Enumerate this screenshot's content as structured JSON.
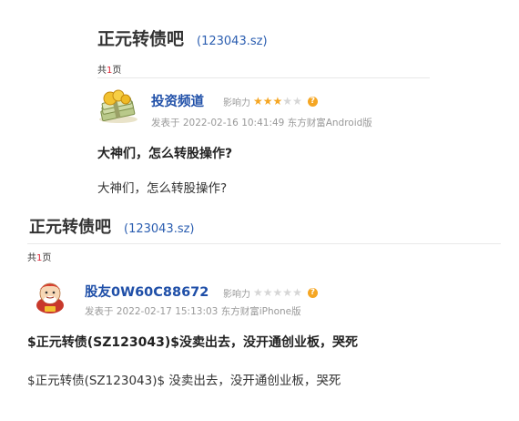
{
  "post1": {
    "forum_title": "正元转债吧",
    "stock_code": "(123043.sz)",
    "pages_prefix": "共",
    "pages_num": "1",
    "pages_suffix": "页",
    "user_name": "投资频道",
    "influence_label": "影响力",
    "stars_on": 3,
    "stars_total": 5,
    "meta": "发表于 2022-02-16 10:41:49 东方财富Android版",
    "post_title": "大神们，怎么转股操作?",
    "post_body": "大神们，怎么转股操作?"
  },
  "post2": {
    "forum_title": "正元转债吧",
    "stock_code": "(123043.sz)",
    "pages_prefix": "共",
    "pages_num": "1",
    "pages_suffix": "页",
    "user_name": "股友0W60C88672",
    "influence_label": "影响力",
    "stars_on": 0,
    "stars_total": 5,
    "meta": "发表于 2022-02-17 15:13:03 东方财富iPhone版",
    "post_title": "$正元转债(SZ123043)$没卖出去，没开通创业板，哭死",
    "post_body": "$正元转债(SZ123043)$ 没卖出去，没开通创业板，哭死"
  },
  "help_icon": "?",
  "colors": {
    "link_blue": "#1f4fa8",
    "code_blue": "#2a5db0",
    "star_on": "#f5a623",
    "star_off": "#d6d6d6",
    "page_num_red": "#dd2233"
  }
}
